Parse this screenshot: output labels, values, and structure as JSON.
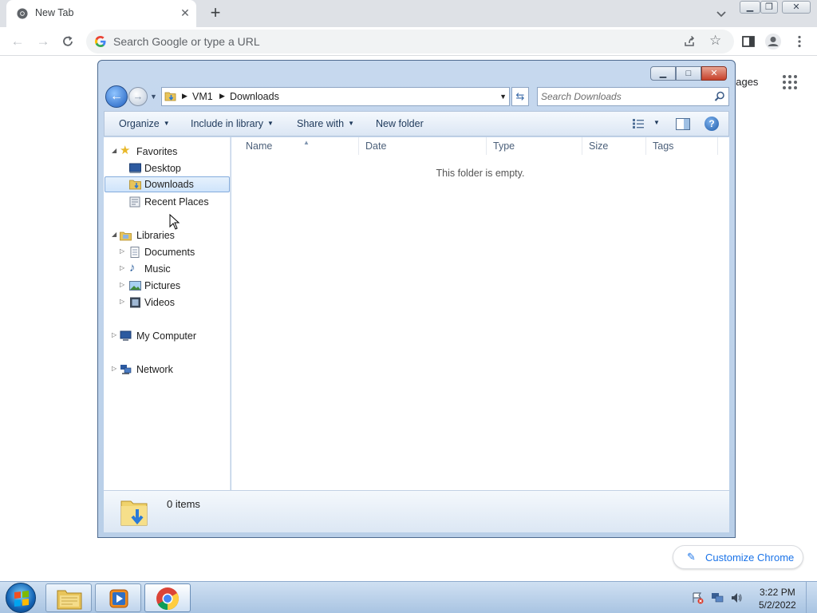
{
  "browser": {
    "tab_title": "New Tab",
    "tab_close_glyph": "✕",
    "new_tab_glyph": "+",
    "omnibox_placeholder": "Search Google or type a URL",
    "ntp_images_link": "nages",
    "customize_label": "Customize Chrome",
    "icons": [
      "chrome-favicon",
      "close-icon",
      "plus-icon",
      "chevron-down-icon",
      "back-arrow-icon",
      "forward-arrow-icon",
      "reload-icon",
      "google-g-icon",
      "share-icon",
      "star-icon",
      "side-panel-icon",
      "profile-icon",
      "kebab-menu-icon",
      "apps-grid-icon",
      "pencil-icon"
    ],
    "accent_color": "#1a73e8"
  },
  "explorer": {
    "breadcrumb": [
      "VM1",
      "Downloads"
    ],
    "search_placeholder": "Search Downloads",
    "commands": {
      "organize": "Organize",
      "include_in_library": "Include in library",
      "share_with": "Share with",
      "new_folder": "New folder"
    },
    "nav": {
      "favorites": "Favorites",
      "desktop": "Desktop",
      "downloads": "Downloads",
      "recent_places": "Recent Places",
      "libraries": "Libraries",
      "documents": "Documents",
      "music": "Music",
      "pictures": "Pictures",
      "videos": "Videos",
      "my_computer": "My Computer",
      "network": "Network",
      "selected": "Downloads"
    },
    "columns": [
      "Name",
      "Date",
      "Type",
      "Size",
      "Tags"
    ],
    "empty_message": "This folder is empty.",
    "status_count": "0 items",
    "help_glyph": "?"
  },
  "taskbar": {
    "time": "3:22 PM",
    "date": "5/2/2022",
    "pinned": [
      "windows-explorer",
      "media-player",
      "google-chrome"
    ]
  }
}
